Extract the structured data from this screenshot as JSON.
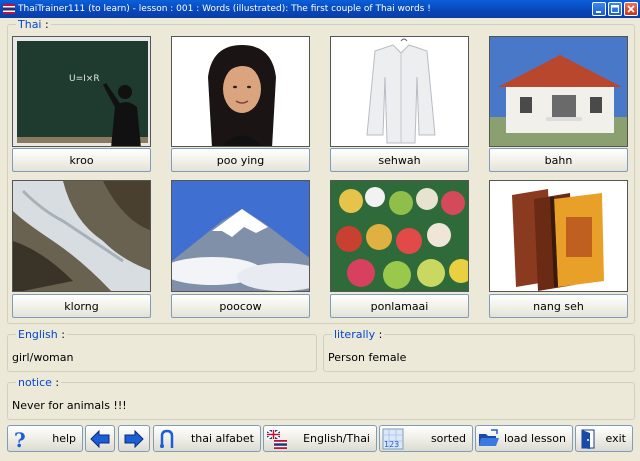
{
  "window": {
    "title": "ThaiTrainer111 (to learn) - lesson : 001 : Words (illustrated): The first couple of Thai words !"
  },
  "thai_group": {
    "label": "Thai",
    "cards": [
      {
        "word": "kroo",
        "image": "teacher-at-blackboard"
      },
      {
        "word": "poo ying",
        "image": "woman-portrait"
      },
      {
        "word": "sehwah",
        "image": "white-shirt"
      },
      {
        "word": "bahn",
        "image": "house"
      },
      {
        "word": "klorng",
        "image": "canal-stream"
      },
      {
        "word": "poocow",
        "image": "snowy-mountain"
      },
      {
        "word": "ponlamaai",
        "image": "fruit-market"
      },
      {
        "word": "nang seh",
        "image": "books"
      }
    ],
    "blackboard_text": "U=I×R"
  },
  "english_group": {
    "label": "English",
    "value": "girl/woman"
  },
  "literally_group": {
    "label": "literally",
    "value": "Person female"
  },
  "notice_group": {
    "label": "notice",
    "value": "Never for animals !!!"
  },
  "toolbar": {
    "help": "help",
    "thai_alfabet": "thai alfabet",
    "english_thai": "English/Thai",
    "sorted": "sorted",
    "sorted_icon_text": "123",
    "load_lesson": "load lesson",
    "exit": "exit"
  },
  "colors": {
    "accent": "#0046d5",
    "titlebar": "#0846b8",
    "arrow": "#1a5fd6"
  }
}
